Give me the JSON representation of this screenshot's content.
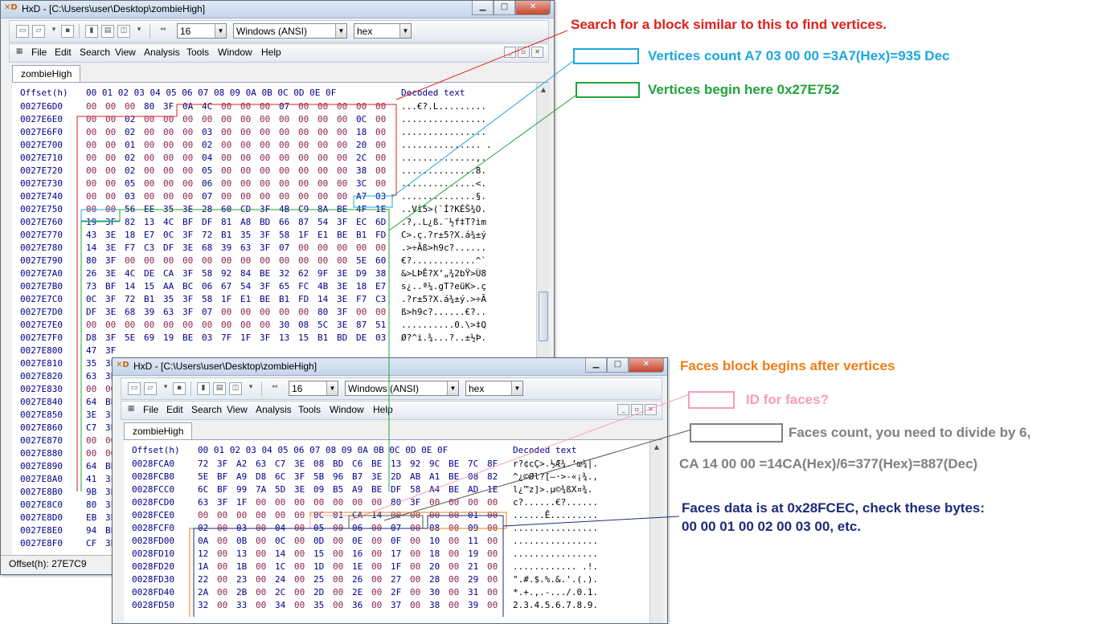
{
  "window1": {
    "title": "HxD - [C:\\Users\\user\\Desktop\\zombieHigh]",
    "toolbar": {
      "bytes_per_row": "16",
      "charset": "Windows (ANSI)",
      "display": "hex"
    },
    "menu": [
      "File",
      "Edit",
      "Search",
      "View",
      "Analysis",
      "Tools",
      "Window",
      "Help"
    ],
    "tab": "zombieHigh",
    "header": {
      "offset": "Offset(h)",
      "cols": "00 01 02 03 04 05 06 07 08 09 0A 0B 0C 0D 0E 0F",
      "decoded": "Decoded text"
    },
    "rows": [
      {
        "offset": "0027E6D0",
        "bytes": [
          "00",
          "00",
          "00",
          "80",
          "3F",
          "0A",
          "4C",
          "00",
          "00",
          "00",
          "07",
          "00",
          "00",
          "00",
          "00",
          "00"
        ],
        "text": "...€?.L........."
      },
      {
        "offset": "0027E6E0",
        "bytes": [
          "00",
          "00",
          "02",
          "00",
          "00",
          "00",
          "00",
          "00",
          "00",
          "00",
          "00",
          "00",
          "00",
          "00",
          "0C",
          "00"
        ],
        "text": "................"
      },
      {
        "offset": "0027E6F0",
        "bytes": [
          "00",
          "00",
          "02",
          "00",
          "00",
          "00",
          "03",
          "00",
          "00",
          "00",
          "00",
          "00",
          "00",
          "00",
          "18",
          "00"
        ],
        "text": "................"
      },
      {
        "offset": "0027E700",
        "bytes": [
          "00",
          "00",
          "01",
          "00",
          "00",
          "00",
          "02",
          "00",
          "00",
          "00",
          "00",
          "00",
          "00",
          "00",
          "20",
          "00"
        ],
        "text": "............... ."
      },
      {
        "offset": "0027E710",
        "bytes": [
          "00",
          "00",
          "02",
          "00",
          "00",
          "00",
          "04",
          "00",
          "00",
          "00",
          "00",
          "00",
          "00",
          "00",
          "2C",
          "00"
        ],
        "text": "..............,."
      },
      {
        "offset": "0027E720",
        "bytes": [
          "00",
          "00",
          "02",
          "00",
          "00",
          "00",
          "05",
          "00",
          "00",
          "00",
          "00",
          "00",
          "00",
          "00",
          "38",
          "00"
        ],
        "text": "..............8."
      },
      {
        "offset": "0027E730",
        "bytes": [
          "00",
          "00",
          "05",
          "00",
          "00",
          "00",
          "06",
          "00",
          "00",
          "00",
          "00",
          "00",
          "00",
          "00",
          "3C",
          "00"
        ],
        "text": "..............<."
      },
      {
        "offset": "0027E740",
        "bytes": [
          "00",
          "00",
          "03",
          "00",
          "00",
          "00",
          "07",
          "00",
          "00",
          "00",
          "00",
          "00",
          "00",
          "00",
          "A7",
          "03"
        ],
        "text": "..............§."
      },
      {
        "offset": "0027E750",
        "bytes": [
          "00",
          "00",
          "56",
          "EE",
          "35",
          "3E",
          "28",
          "60",
          "CD",
          "3F",
          "4B",
          "C9",
          "8A",
          "BE",
          "4F",
          "1E"
        ],
        "text": "..Vî5>(`Í?KÉŠ¾O."
      },
      {
        "offset": "0027E760",
        "bytes": [
          "19",
          "3F",
          "82",
          "13",
          "4C",
          "BF",
          "DF",
          "81",
          "A8",
          "BD",
          "66",
          "87",
          "54",
          "3F",
          "EC",
          "6D"
        ],
        "text": ".?‚.L¿ß.¨½f‡T?ìm"
      },
      {
        "offset": "0027E770",
        "bytes": [
          "43",
          "3E",
          "18",
          "E7",
          "0C",
          "3F",
          "72",
          "B1",
          "35",
          "3F",
          "58",
          "1F",
          "E1",
          "BE",
          "B1",
          "FD"
        ],
        "text": "C>.ç.?r±5?X.á¾±ý"
      },
      {
        "offset": "0027E780",
        "bytes": [
          "14",
          "3E",
          "F7",
          "C3",
          "DF",
          "3E",
          "68",
          "39",
          "63",
          "3F",
          "07",
          "00",
          "00",
          "00",
          "00",
          "00"
        ],
        "text": ".>÷Ãß>h9c?......"
      },
      {
        "offset": "0027E790",
        "bytes": [
          "80",
          "3F",
          "00",
          "00",
          "00",
          "00",
          "00",
          "00",
          "00",
          "00",
          "00",
          "00",
          "00",
          "00",
          "5E",
          "60"
        ],
        "text": "€?............^`"
      },
      {
        "offset": "0027E7A0",
        "bytes": [
          "26",
          "3E",
          "4C",
          "DE",
          "CA",
          "3F",
          "58",
          "92",
          "84",
          "BE",
          "32",
          "62",
          "9F",
          "3E",
          "D9",
          "38"
        ],
        "text": "&>LÞÊ?X’„¾2bŸ>Ù8"
      },
      {
        "offset": "0027E7B0",
        "bytes": [
          "73",
          "BF",
          "14",
          "15",
          "AA",
          "BC",
          "06",
          "67",
          "54",
          "3F",
          "65",
          "FC",
          "4B",
          "3E",
          "18",
          "E7"
        ],
        "text": "s¿..ª¼.gT?eüK>.ç"
      },
      {
        "offset": "0027E7C0",
        "bytes": [
          "0C",
          "3F",
          "72",
          "B1",
          "35",
          "3F",
          "58",
          "1F",
          "E1",
          "BE",
          "B1",
          "FD",
          "14",
          "3E",
          "F7",
          "C3"
        ],
        "text": ".?r±5?X.á¾±ý.>÷Ã"
      },
      {
        "offset": "0027E7D0",
        "bytes": [
          "DF",
          "3E",
          "68",
          "39",
          "63",
          "3F",
          "07",
          "00",
          "00",
          "00",
          "00",
          "00",
          "80",
          "3F",
          "00",
          "00"
        ],
        "text": "ß>h9c?......€?.."
      },
      {
        "offset": "0027E7E0",
        "bytes": [
          "00",
          "00",
          "00",
          "00",
          "00",
          "00",
          "00",
          "00",
          "00",
          "00",
          "30",
          "08",
          "5C",
          "3E",
          "87",
          "51"
        ],
        "text": "..........0.\\>‡Q"
      },
      {
        "offset": "0027E7F0",
        "bytes": [
          "D8",
          "3F",
          "5E",
          "69",
          "19",
          "BE",
          "03",
          "7F",
          "1F",
          "3F",
          "13",
          "15",
          "B1",
          "BD",
          "DE",
          "03"
        ],
        "text": "Ø?^i.¾...?..±½Þ."
      },
      {
        "offset": "0027E800",
        "bytes": [
          "47",
          "3F",
          "",
          "",
          "",
          "",
          "",
          "",
          "",
          "",
          "",
          "",
          "",
          "",
          "",
          ""
        ],
        "text": ""
      },
      {
        "offset": "0027E810",
        "bytes": [
          "35",
          "3E",
          "",
          "",
          "",
          "",
          "",
          "",
          "",
          "",
          "",
          "",
          "",
          "",
          "",
          ""
        ],
        "text": ""
      },
      {
        "offset": "0027E820",
        "bytes": [
          "63",
          "3E",
          "",
          "",
          "",
          "",
          "",
          "",
          "",
          "",
          "",
          "",
          "",
          "",
          "",
          ""
        ],
        "text": ""
      },
      {
        "offset": "0027E830",
        "bytes": [
          "00",
          "00",
          "",
          "",
          "",
          "",
          "",
          "",
          "",
          "",
          "",
          "",
          "",
          "",
          "",
          ""
        ],
        "text": ""
      },
      {
        "offset": "0027E840",
        "bytes": [
          "64",
          "BE",
          "",
          "",
          "",
          "",
          "",
          "",
          "",
          "",
          "",
          "",
          "",
          "",
          "",
          ""
        ],
        "text": ""
      },
      {
        "offset": "0027E850",
        "bytes": [
          "3E",
          "3F",
          "",
          "",
          "",
          "",
          "",
          "",
          "",
          "",
          "",
          "",
          "",
          "",
          "",
          ""
        ],
        "text": ""
      },
      {
        "offset": "0027E860",
        "bytes": [
          "C7",
          "3E",
          "",
          "",
          "",
          "",
          "",
          "",
          "",
          "",
          "",
          "",
          "",
          "",
          "",
          ""
        ],
        "text": ""
      },
      {
        "offset": "0027E870",
        "bytes": [
          "00",
          "00",
          "",
          "",
          "",
          "",
          "",
          "",
          "",
          "",
          "",
          "",
          "",
          "",
          "",
          ""
        ],
        "text": ""
      },
      {
        "offset": "0027E880",
        "bytes": [
          "00",
          "00",
          "",
          "",
          "",
          "",
          "",
          "",
          "",
          "",
          "",
          "",
          "",
          "",
          "",
          ""
        ],
        "text": ""
      },
      {
        "offset": "0027E890",
        "bytes": [
          "64",
          "BE",
          "",
          "",
          "",
          "",
          "",
          "",
          "",
          "",
          "",
          "",
          "",
          "",
          "",
          ""
        ],
        "text": ""
      },
      {
        "offset": "0027E8A0",
        "bytes": [
          "41",
          "3F",
          "",
          "",
          "",
          "",
          "",
          "",
          "",
          "",
          "",
          "",
          "",
          "",
          "",
          ""
        ],
        "text": ""
      },
      {
        "offset": "0027E8B0",
        "bytes": [
          "9B",
          "3E",
          "",
          "",
          "",
          "",
          "",
          "",
          "",
          "",
          "",
          "",
          "",
          "",
          "",
          ""
        ],
        "text": ""
      },
      {
        "offset": "0027E8C0",
        "bytes": [
          "80",
          "3F",
          "",
          "",
          "",
          "",
          "",
          "",
          "",
          "",
          "",
          "",
          "",
          "",
          "",
          ""
        ],
        "text": ""
      },
      {
        "offset": "0027E8D0",
        "bytes": [
          "EB",
          "3E",
          "",
          "",
          "",
          "",
          "",
          "",
          "",
          "",
          "",
          "",
          "",
          "",
          "",
          ""
        ],
        "text": ""
      },
      {
        "offset": "0027E8E0",
        "bytes": [
          "94",
          "BE",
          "",
          "",
          "",
          "",
          "",
          "",
          "",
          "",
          "",
          "",
          "",
          "",
          "",
          ""
        ],
        "text": ""
      },
      {
        "offset": "0027E8F0",
        "bytes": [
          "CF",
          "3E",
          "",
          "",
          "",
          "",
          "",
          "",
          "",
          "",
          "",
          "",
          "",
          "",
          "",
          ""
        ],
        "text": ""
      }
    ],
    "status": "Offset(h): 27E7C9"
  },
  "window2": {
    "title": "HxD - [C:\\Users\\user\\Desktop\\zombieHigh]",
    "toolbar": {
      "bytes_per_row": "16",
      "charset": "Windows (ANSI)",
      "display": "hex"
    },
    "menu": [
      "File",
      "Edit",
      "Search",
      "View",
      "Analysis",
      "Tools",
      "Window",
      "Help"
    ],
    "tab": "zombieHigh",
    "header": {
      "offset": "Offset(h)",
      "cols": "00 01 02 03 04 05 06 07 08 09 0A 0B 0C 0D 0E 0F",
      "decoded": "Decoded text"
    },
    "rows": [
      {
        "offset": "0028FCA0",
        "bytes": [
          "72",
          "3F",
          "A2",
          "63",
          "C7",
          "3E",
          "08",
          "BD",
          "C6",
          "BE",
          "13",
          "92",
          "9C",
          "BE",
          "7C",
          "8F"
        ],
        "text": "r?¢cÇ>.½Æ¾.’œ¾|."
      },
      {
        "offset": "0028FCB0",
        "bytes": [
          "5E",
          "BF",
          "A9",
          "D8",
          "6C",
          "3F",
          "5B",
          "96",
          "B7",
          "3E",
          "2D",
          "AB",
          "A1",
          "BE",
          "08",
          "82"
        ],
        "text": "^¿©Øl?[–·>-«¡¾.‚"
      },
      {
        "offset": "0028FCC0",
        "bytes": [
          "6C",
          "BF",
          "99",
          "7A",
          "5D",
          "3E",
          "09",
          "B5",
          "A9",
          "BE",
          "DF",
          "58",
          "A4",
          "BE",
          "AD",
          "1E"
        ],
        "text": "l¿™z]>.µ©¾ßX¤¾­."
      },
      {
        "offset": "0028FCD0",
        "bytes": [
          "63",
          "3F",
          "1F",
          "00",
          "00",
          "00",
          "00",
          "00",
          "00",
          "00",
          "80",
          "3F",
          "00",
          "00",
          "00",
          "00"
        ],
        "text": "c?......€?......"
      },
      {
        "offset": "0028FCE0",
        "bytes": [
          "00",
          "00",
          "00",
          "00",
          "00",
          "00",
          "0C",
          "01",
          "CA",
          "14",
          "00",
          "00",
          "00",
          "00",
          "01",
          "00"
        ],
        "text": "......Ê........."
      },
      {
        "offset": "0028FCF0",
        "bytes": [
          "02",
          "00",
          "03",
          "00",
          "04",
          "00",
          "05",
          "00",
          "06",
          "00",
          "07",
          "00",
          "08",
          "00",
          "09",
          "00"
        ],
        "text": "................"
      },
      {
        "offset": "0028FD00",
        "bytes": [
          "0A",
          "00",
          "0B",
          "00",
          "0C",
          "00",
          "0D",
          "00",
          "0E",
          "00",
          "0F",
          "00",
          "10",
          "00",
          "11",
          "00"
        ],
        "text": "................"
      },
      {
        "offset": "0028FD10",
        "bytes": [
          "12",
          "00",
          "13",
          "00",
          "14",
          "00",
          "15",
          "00",
          "16",
          "00",
          "17",
          "00",
          "18",
          "00",
          "19",
          "00"
        ],
        "text": "................"
      },
      {
        "offset": "0028FD20",
        "bytes": [
          "1A",
          "00",
          "1B",
          "00",
          "1C",
          "00",
          "1D",
          "00",
          "1E",
          "00",
          "1F",
          "00",
          "20",
          "00",
          "21",
          "00"
        ],
        "text": "............ .!."
      },
      {
        "offset": "0028FD30",
        "bytes": [
          "22",
          "00",
          "23",
          "00",
          "24",
          "00",
          "25",
          "00",
          "26",
          "00",
          "27",
          "00",
          "28",
          "00",
          "29",
          "00"
        ],
        "text": "\".#.$.%.&.'.(.)."
      },
      {
        "offset": "0028FD40",
        "bytes": [
          "2A",
          "00",
          "2B",
          "00",
          "2C",
          "00",
          "2D",
          "00",
          "2E",
          "00",
          "2F",
          "00",
          "30",
          "00",
          "31",
          "00"
        ],
        "text": "*.+.,.-.../.0.1."
      },
      {
        "offset": "0028FD50",
        "bytes": [
          "32",
          "00",
          "33",
          "00",
          "34",
          "00",
          "35",
          "00",
          "36",
          "00",
          "37",
          "00",
          "38",
          "00",
          "39",
          "00"
        ],
        "text": "2.3.4.5.6.7.8.9."
      }
    ]
  },
  "annotations": {
    "search_block": "Search for a block similar to this to find vertices.",
    "vertices_count": "Vertices count A7 03 00 00 =3A7(Hex)=935 Dec",
    "vertices_begin": "Vertices begin here 0x27E752",
    "faces_block": "Faces block begins after vertices",
    "faces_id": "ID for faces?",
    "faces_count_1": "Faces count, you need to divide by 6,",
    "faces_count_2": "CA 14 00 00 =14CA(Hex)/6=377(Hex)=887(Dec)",
    "faces_data_1": "Faces data is at 0x28FCEC, check these bytes:",
    "faces_data_2": "00 00 01 00 02 00 03 00, etc."
  },
  "colors": {
    "red": "#e0201b",
    "cyan": "#1ba8e0",
    "green": "#1fa33a",
    "orange": "#f07d16",
    "pink": "#f4a0b4",
    "gray": "#808080",
    "navy": "#1e2a7a"
  }
}
